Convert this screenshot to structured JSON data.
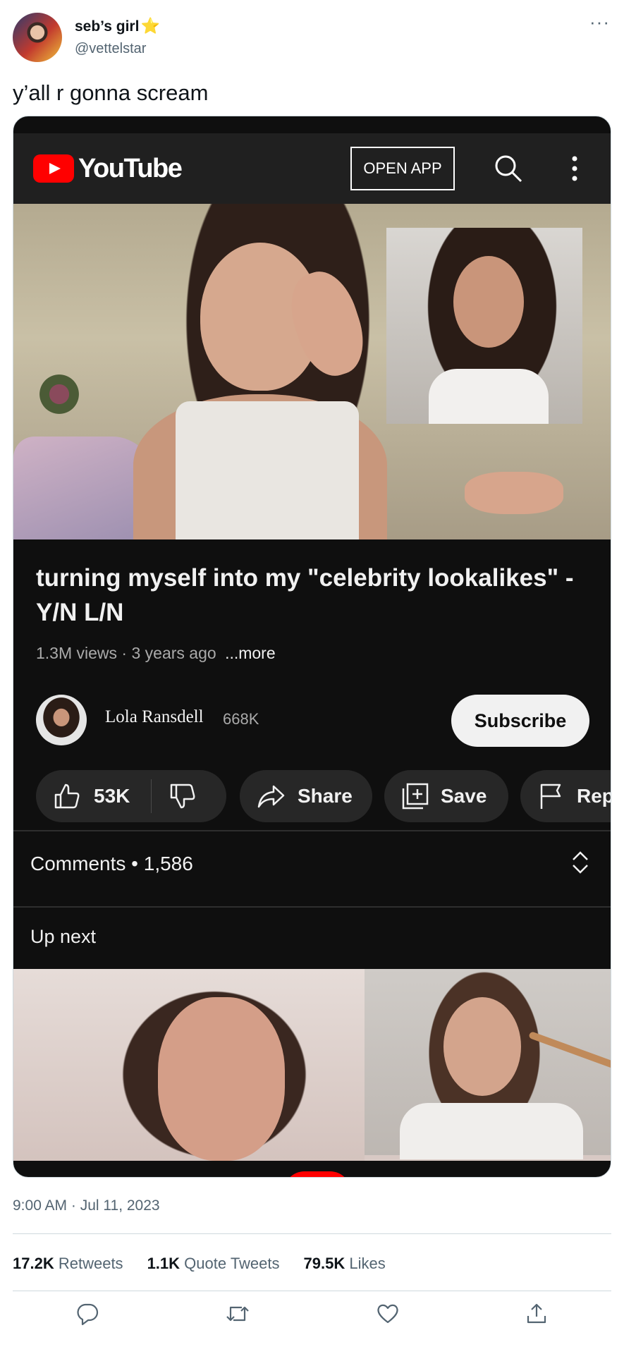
{
  "tweet": {
    "display_name": "seb’s girl",
    "star": "⭐",
    "handle": "@vettelstar",
    "more": "···",
    "text": "y’all r gonna scream",
    "timestamp": "9:00 AM · Jul 11, 2023",
    "stats": {
      "retweets_count": "17.2K",
      "retweets_label": "Retweets",
      "quotes_count": "1.1K",
      "quotes_label": "Quote Tweets",
      "likes_count": "79.5K",
      "likes_label": "Likes"
    },
    "actions": [
      "reply-icon",
      "retweet-icon",
      "like-icon",
      "share-icon"
    ]
  },
  "youtube": {
    "brand": "YouTube",
    "open_app": "OPEN APP",
    "video_title_line1": "turning myself into my \"celebrity lookalikes\" -",
    "video_title_line2": "Y/N L/N",
    "views": "1.3M views · 3 years ago",
    "more": "...more",
    "channel_name": "Lola Ransdell",
    "subscribers": "668K",
    "subscribe": "Subscribe",
    "likes": "53K",
    "share": "Share",
    "save": "Save",
    "report": "Rep",
    "comments_label": "Comments",
    "comments_count": "1,586",
    "up_next": "Up next",
    "colors": {
      "red": "#ff0000",
      "bg": "#0f0f0f",
      "bar": "#202020",
      "pill": "#272727"
    }
  }
}
